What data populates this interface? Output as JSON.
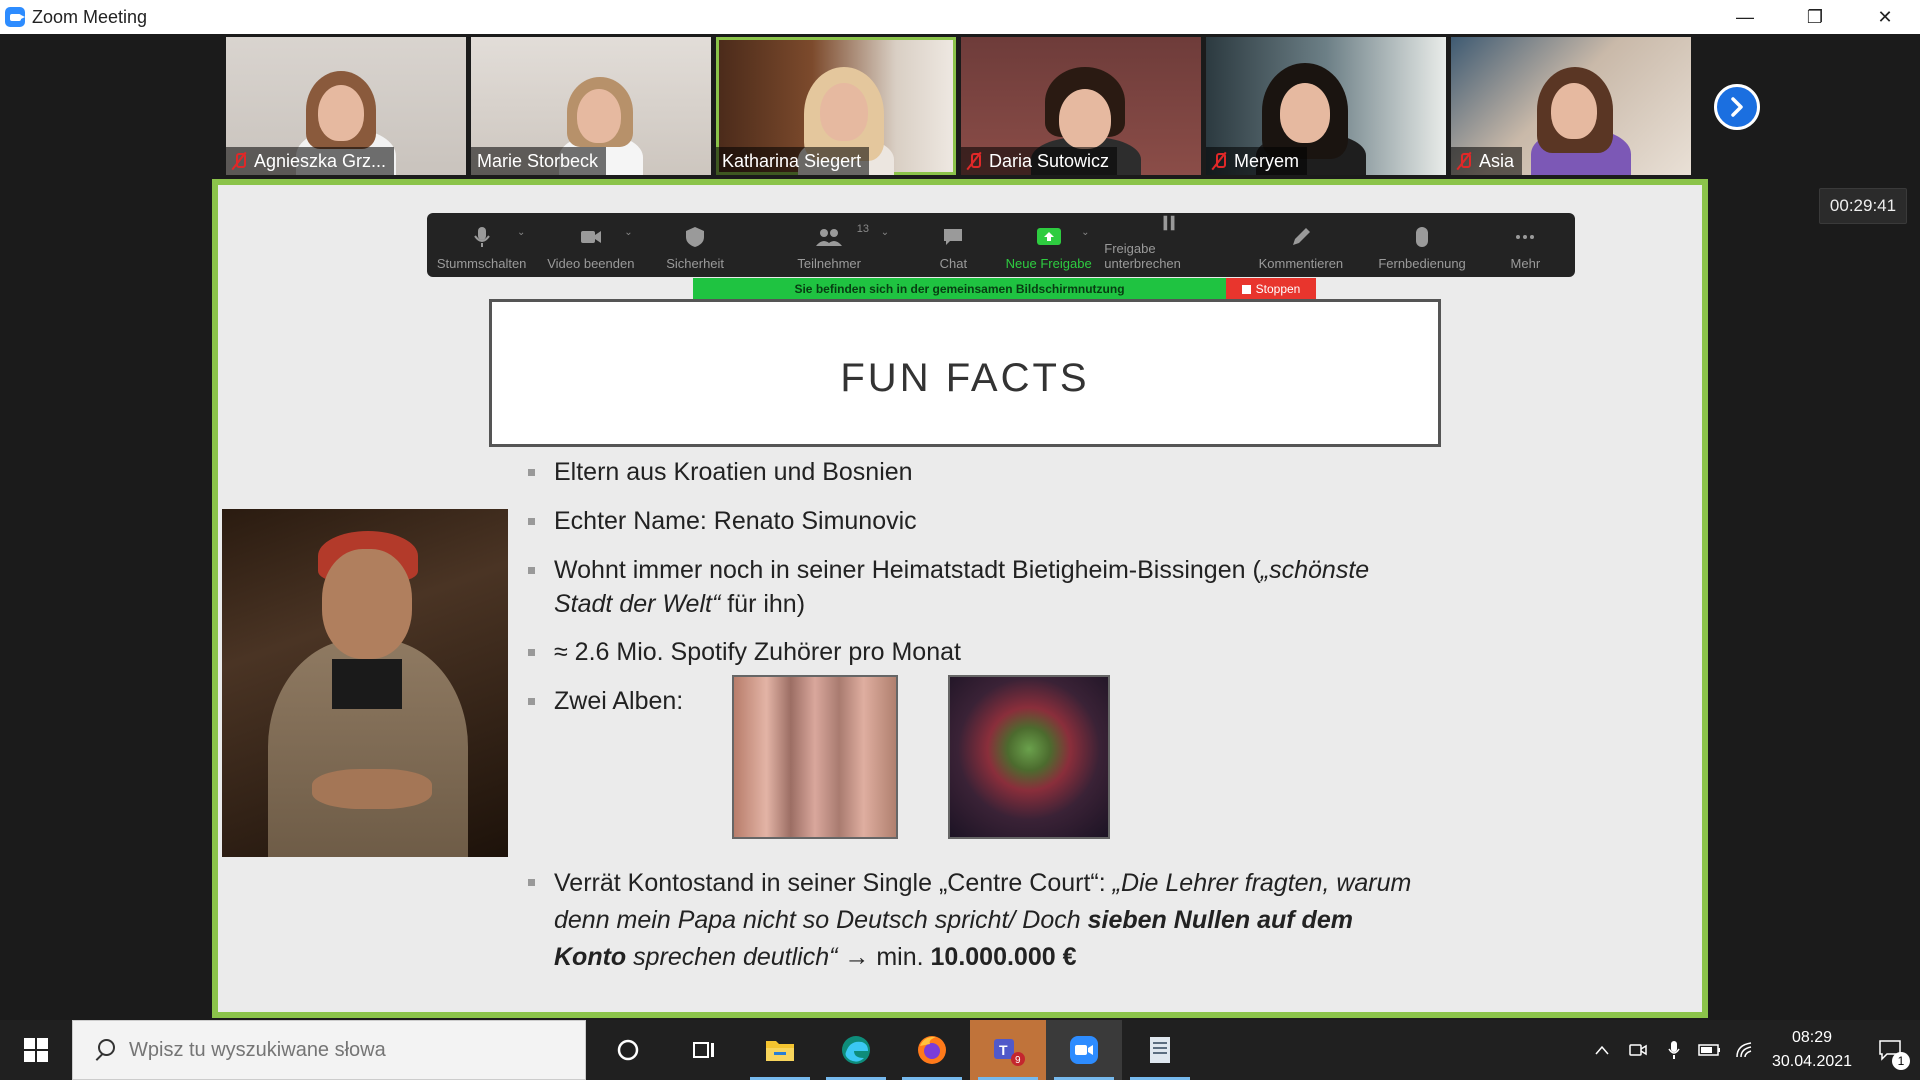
{
  "window": {
    "title": "Zoom Meeting",
    "controls": [
      "—",
      "❐",
      "✕"
    ]
  },
  "participants": [
    {
      "name": "Agnieszka Grz...",
      "muted": true,
      "active": false
    },
    {
      "name": "Marie Storbeck",
      "muted": false,
      "active": false
    },
    {
      "name": "Katharina Siegert",
      "muted": false,
      "active": true
    },
    {
      "name": "Daria Sutowicz",
      "muted": true,
      "active": false
    },
    {
      "name": "Meryem",
      "muted": true,
      "active": false
    },
    {
      "name": "Asia",
      "muted": true,
      "active": false
    }
  ],
  "timer": "00:29:41",
  "toolbar": {
    "mute": "Stummschalten",
    "video": "Video beenden",
    "security": "Sicherheit",
    "participants": "Teilnehmer",
    "participants_count": "13",
    "chat": "Chat",
    "new_share": "Neue Freigabe",
    "pause_share": "Freigabe unterbrechen",
    "annotate": "Kommentieren",
    "remote": "Fernbedienung",
    "more": "Mehr"
  },
  "share_banner": {
    "text": "Sie befinden sich in der gemeinsamen Bildschirmnutzung",
    "stop": "Stoppen"
  },
  "slide": {
    "title": "FUN FACTS",
    "b1": "Eltern aus Kroatien und Bosnien",
    "b2": "Echter Name: Renato Simunovic",
    "b3_a": "Wohnt immer noch in seiner Heimatstadt Bietigheim-Bissingen (",
    "b3_b": "„schönste Stadt der Welt“",
    "b3_c": " für ihn)",
    "b4": "≈ 2.6 Mio. Spotify Zuhörer pro Monat",
    "b5": "Zwei Alben:",
    "b6_a": "Verrät Kontostand in seiner Single „Centre Court“: ",
    "b6_b": "„Die Lehrer fragten, warum denn mein Papa nicht so Deutsch spricht/ Doch ",
    "b6_c": "sieben Nullen auf dem Konto",
    "b6_d": " sprechen deutlich“",
    "b6_e": " → min. ",
    "b6_f": "10.000.000 €"
  },
  "taskbar": {
    "search_placeholder": "Wpisz tu wyszukiwane słowa",
    "teams_badge": "9",
    "time": "08:29",
    "date": "30.04.2021",
    "notifications": "1"
  }
}
